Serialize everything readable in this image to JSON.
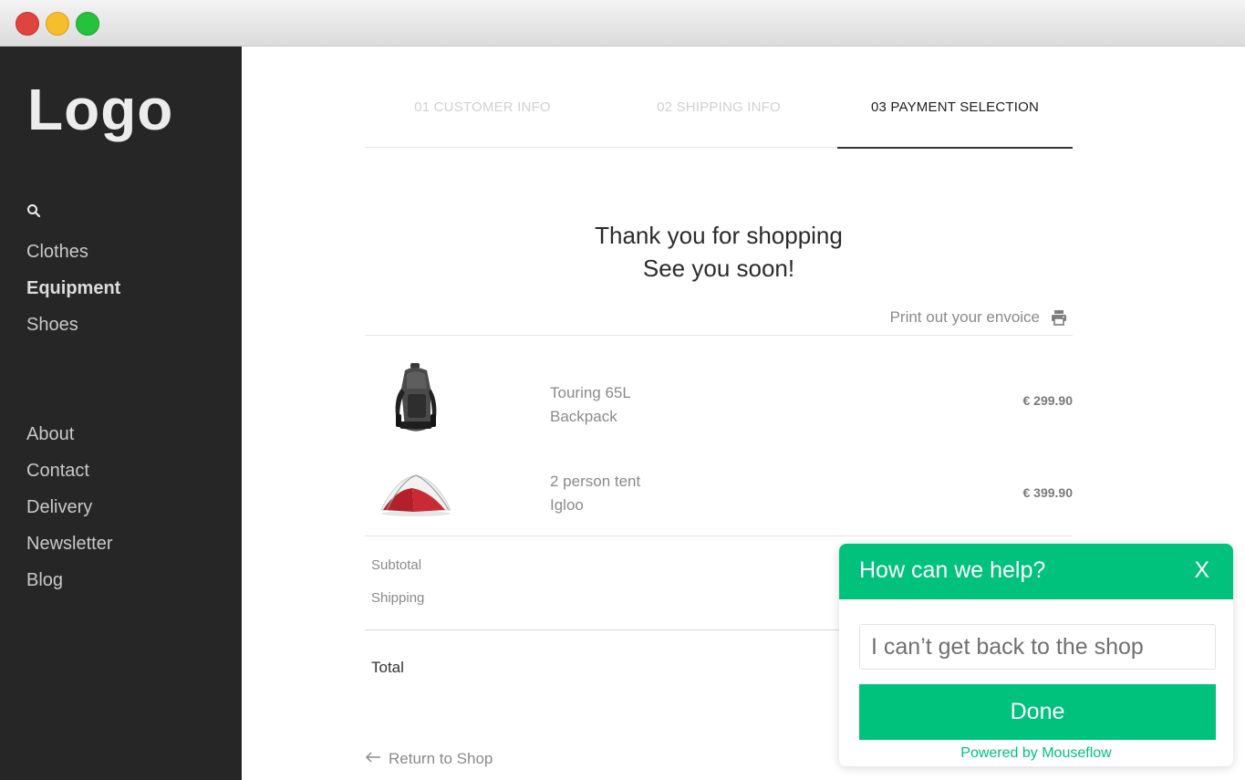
{
  "sidebar": {
    "logo": "Logo",
    "search_icon": "search-icon",
    "nav_primary": [
      {
        "label": "Clothes",
        "active": false
      },
      {
        "label": "Equipment",
        "active": true
      },
      {
        "label": "Shoes",
        "active": false
      }
    ],
    "nav_secondary": [
      {
        "label": "About"
      },
      {
        "label": "Contact"
      },
      {
        "label": "Delivery"
      },
      {
        "label": "Newsletter"
      },
      {
        "label": "Blog"
      }
    ]
  },
  "steps": [
    {
      "label": "01 CUSTOMER INFO",
      "state": "done"
    },
    {
      "label": "02 SHIPPING INFO",
      "state": "done"
    },
    {
      "label": "03 PAYMENT SELECTION",
      "state": "current"
    }
  ],
  "thanks": {
    "line1": "Thank you for shopping",
    "line2": "See you soon!"
  },
  "print": {
    "label": "Print out your envoice",
    "icon": "printer-icon"
  },
  "products": [
    {
      "name_line1": "Touring 65L",
      "name_line2": "Backpack",
      "price": "€ 299.90",
      "icon": "backpack-image"
    },
    {
      "name_line1": "2 person tent",
      "name_line2": "Igloo",
      "price": "€ 399.90",
      "icon": "tent-image"
    }
  ],
  "summary": {
    "subtotal_label": "Subtotal",
    "shipping_label": "Shipping",
    "total_label": "Total"
  },
  "return_link": {
    "label": "Return to Shop",
    "icon": "arrow-left-icon"
  },
  "help_widget": {
    "title": "How can we help?",
    "close_label": "X",
    "input_value": "I can’t get back to the shop",
    "done_label": "Done",
    "powered_by": "Powered by Mouseflow",
    "accent_color": "#00c27d"
  }
}
